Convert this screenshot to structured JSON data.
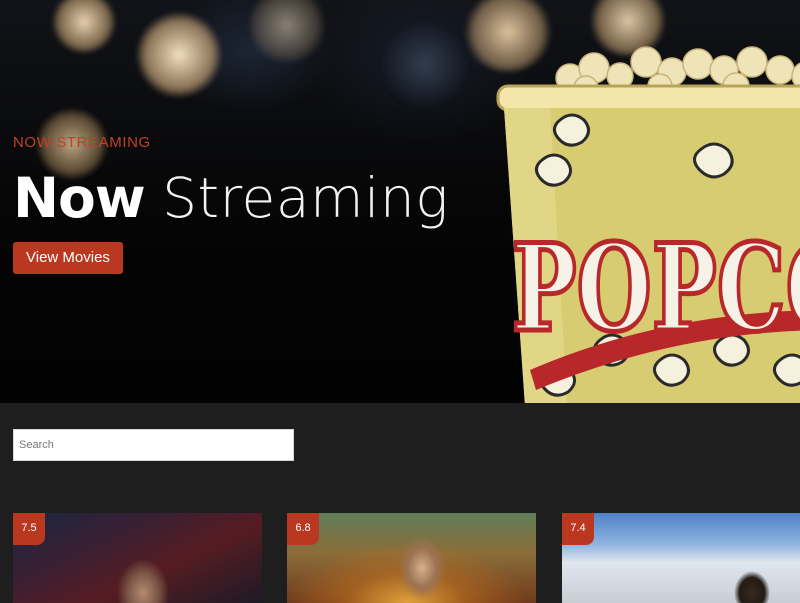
{
  "hero": {
    "eyebrow": "NOW STREAMING",
    "title_strong": "Now",
    "title_light": "Streaming",
    "cta_label": "View Movies",
    "art_text": "POPCORN"
  },
  "search": {
    "placeholder": "Search",
    "value": ""
  },
  "movies": [
    {
      "rating": "7.5"
    },
    {
      "rating": "6.8"
    },
    {
      "rating": "7.4"
    }
  ],
  "colors": {
    "accent": "#b9381f",
    "background": "#1e1e1f",
    "hero_background": "#070707",
    "text": "#ffffff"
  }
}
